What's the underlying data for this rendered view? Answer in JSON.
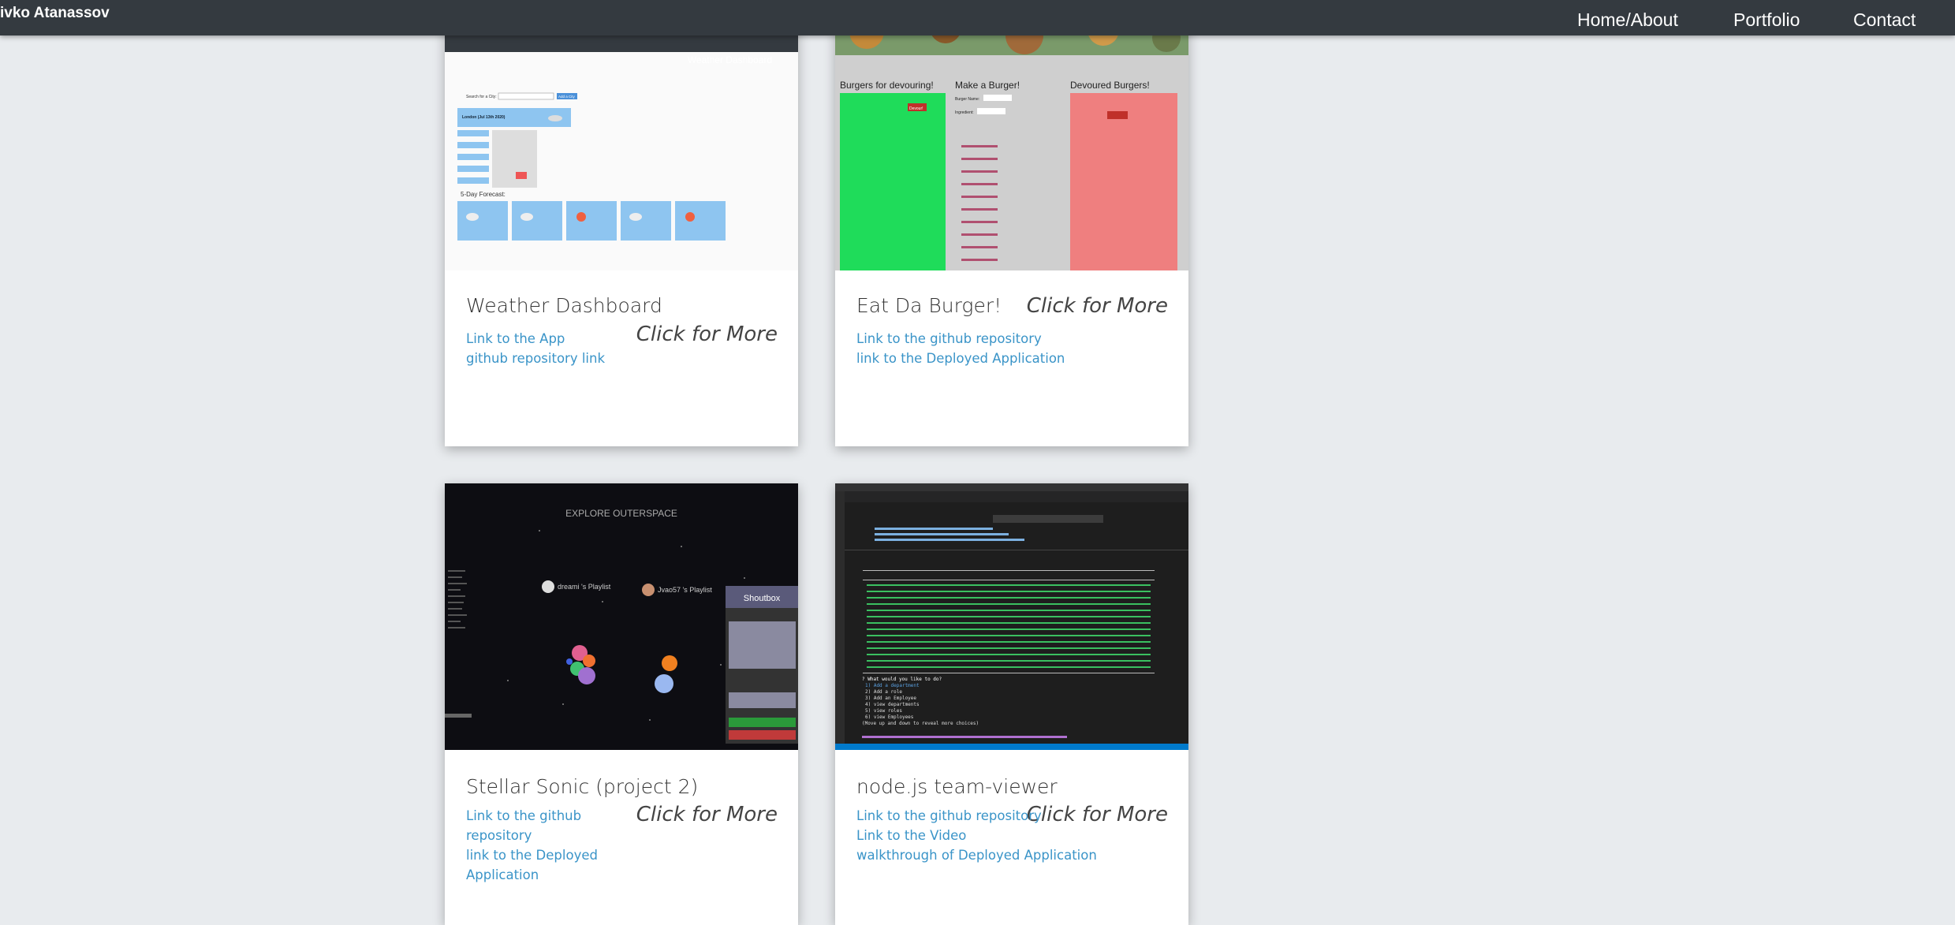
{
  "nav": {
    "brand": "ivko Atanassov",
    "links": [
      "Home/About",
      "Portfolio",
      "Contact"
    ]
  },
  "cards": [
    {
      "title": "Weather Dashboard",
      "click_more": "Click for More",
      "links": [
        "Link to the App",
        "github repository link"
      ],
      "thumb": {
        "header_title": "Weather Dashboard",
        "search_label": "Search for a City:",
        "search_button": "Add a City",
        "city_heading": "London (Jul 13th 2020)",
        "forecast_label": "5-Day Forecast:"
      }
    },
    {
      "title": "Eat Da Burger!",
      "click_more": "Click for More",
      "links": [
        "Link to the github repository",
        "link to the Deployed Application"
      ],
      "thumb": {
        "col1": "Burgers for devouring!",
        "col2": "Make a Burger!",
        "col3": "Devoured Burgers!",
        "burger_name_label": "Burger Name:",
        "ingredient_label": "Ingredient:",
        "devour_button": "Devour!"
      }
    },
    {
      "title": "Stellar Sonic (project 2)",
      "click_more": "Click for More",
      "links": [
        "Link to the github repository",
        "link to the Deployed Application"
      ],
      "thumb": {
        "heading": "EXPLORE OUTERSPACE",
        "playlist1": "dreami 's Playlist",
        "playlist2": "Jvao57 's Playlist",
        "shoutbox": "Shoutbox"
      }
    },
    {
      "title": "node.js team-viewer",
      "click_more": "Click for More",
      "links": [
        "Link to the github repository",
        "Link to the Video",
        "walkthrough of Deployed Application"
      ],
      "thumb": {
        "prompt": "? What would you like to do?",
        "menu": [
          "1) Add a department",
          "2) Add a role",
          "3) Add an Employee",
          "4) view departments",
          "5) view roles",
          "6) view Employees"
        ],
        "hint": "(Move up and down to reveal more choices)"
      }
    }
  ]
}
